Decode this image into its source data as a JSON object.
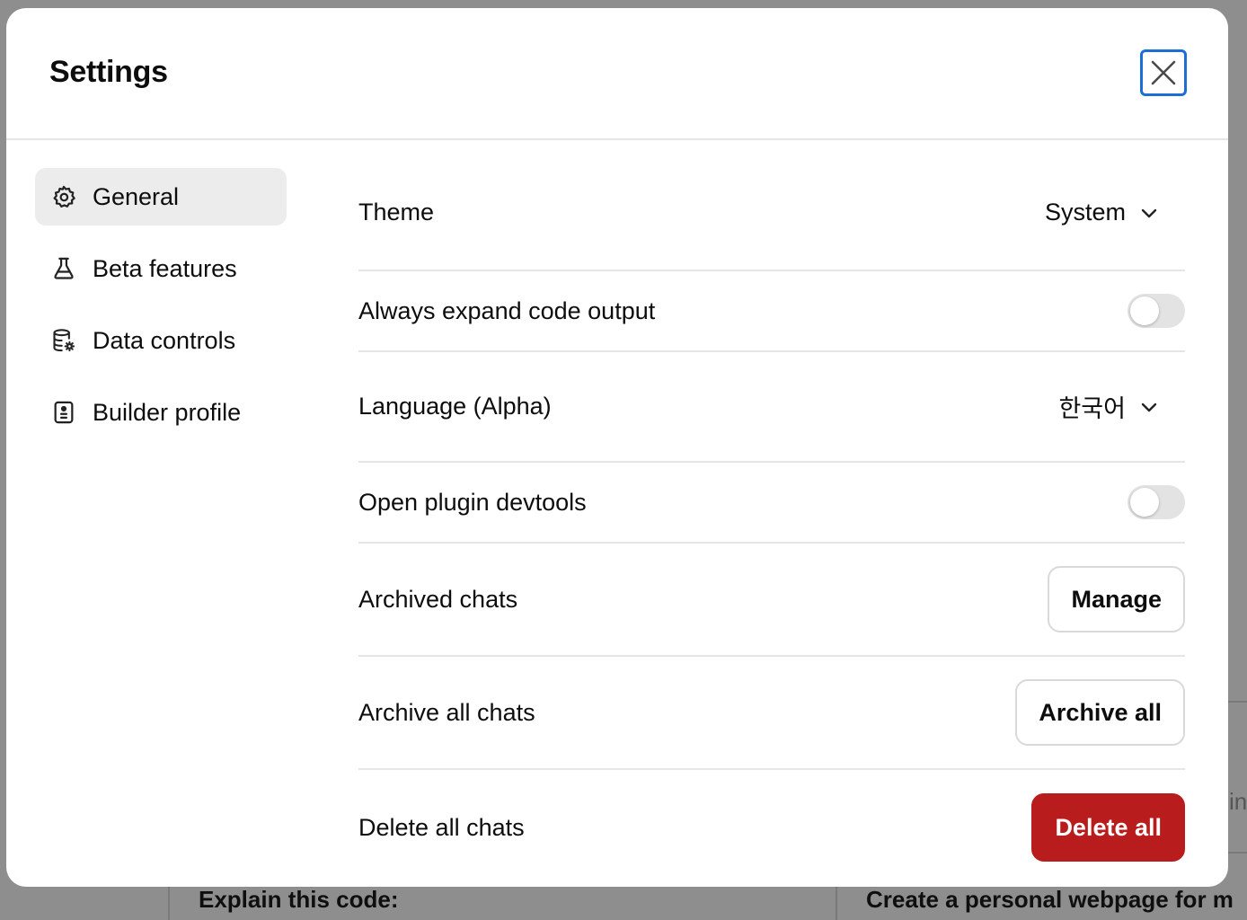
{
  "background": {
    "card_left_text": "Explain this code:",
    "card_right_text": "Create a personal webpage for m",
    "right_edge_text": "in"
  },
  "dialog": {
    "title": "Settings"
  },
  "sidebar": {
    "items": [
      {
        "label": "General",
        "icon": "gear-icon",
        "active": true
      },
      {
        "label": "Beta features",
        "icon": "flask-icon",
        "active": false
      },
      {
        "label": "Data controls",
        "icon": "database-settings-icon",
        "active": false
      },
      {
        "label": "Builder profile",
        "icon": "id-badge-icon",
        "active": false
      }
    ]
  },
  "settings": {
    "theme": {
      "label": "Theme",
      "value": "System"
    },
    "expand_code": {
      "label": "Always expand code output",
      "enabled": false
    },
    "language": {
      "label": "Language (Alpha)",
      "value": "한국어"
    },
    "plugin_devtools": {
      "label": "Open plugin devtools",
      "enabled": false
    },
    "archived_chats": {
      "label": "Archived chats",
      "button": "Manage"
    },
    "archive_all": {
      "label": "Archive all chats",
      "button": "Archive all"
    },
    "delete_all": {
      "label": "Delete all chats",
      "button": "Delete all"
    }
  },
  "colors": {
    "danger": "#b91c1c",
    "focus_ring": "#1a6fd0",
    "active_nav_bg": "#ececec"
  }
}
